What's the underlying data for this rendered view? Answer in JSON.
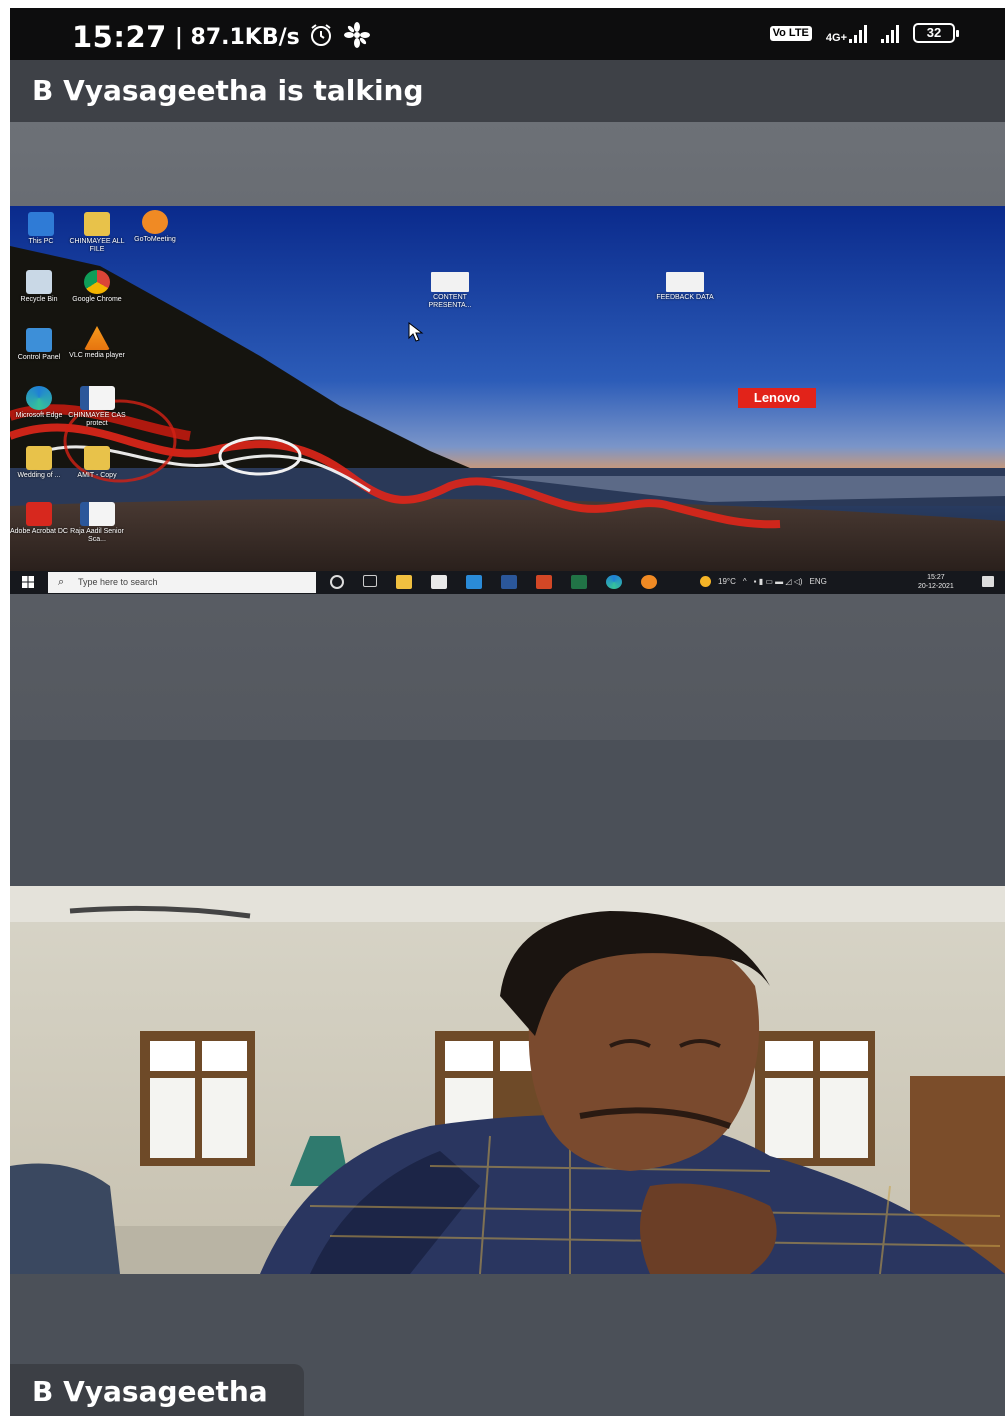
{
  "status_bar": {
    "time": "15:27",
    "network_speed": "| 87.1KB/s",
    "alarm_icon": "alarm-clock-icon",
    "app_icon": "pinwheel-icon",
    "volte_label": "Vo LTE",
    "network_type": "4G+",
    "battery_level": "32"
  },
  "meeting": {
    "speaker_banner": "B Vyasageetha is talking",
    "participant_name": "B Vyasageetha"
  },
  "shared_screen": {
    "desktop_icons": [
      {
        "label": "This PC",
        "icon": "computer-icon"
      },
      {
        "label": "CHINMAYEE ALL FILE",
        "icon": "folder-icon"
      },
      {
        "label": "GoToMeeting",
        "icon": "gotomeeting-icon"
      },
      {
        "label": "Recycle Bin",
        "icon": "recycle-bin-icon"
      },
      {
        "label": "Google Chrome",
        "icon": "chrome-icon"
      },
      {
        "label": "Control Panel",
        "icon": "control-panel-icon"
      },
      {
        "label": "VLC media player",
        "icon": "vlc-icon"
      },
      {
        "label": "Microsoft Edge",
        "icon": "edge-icon"
      },
      {
        "label": "CHINMAYEE CAS protect",
        "icon": "word-doc-icon"
      },
      {
        "label": "Wedding of ... ",
        "icon": "folder-icon"
      },
      {
        "label": "AMIT - Copy",
        "icon": "folder-icon"
      },
      {
        "label": "Adobe Acrobat DC",
        "icon": "acrobat-icon"
      },
      {
        "label": "Raja Aadil Senior Sca...",
        "icon": "word-doc-icon"
      },
      {
        "label": "CONTENT PRESENTA...",
        "icon": "ppt-file-icon"
      },
      {
        "label": "FEEDBACK DATA",
        "icon": "ppt-file-icon"
      }
    ],
    "brand_badge": "Lenovo",
    "taskbar": {
      "search_placeholder": "Type here to search",
      "weather": "19°C",
      "language": "ENG",
      "clock_time": "15:27",
      "clock_date": "20-12-2021"
    }
  }
}
